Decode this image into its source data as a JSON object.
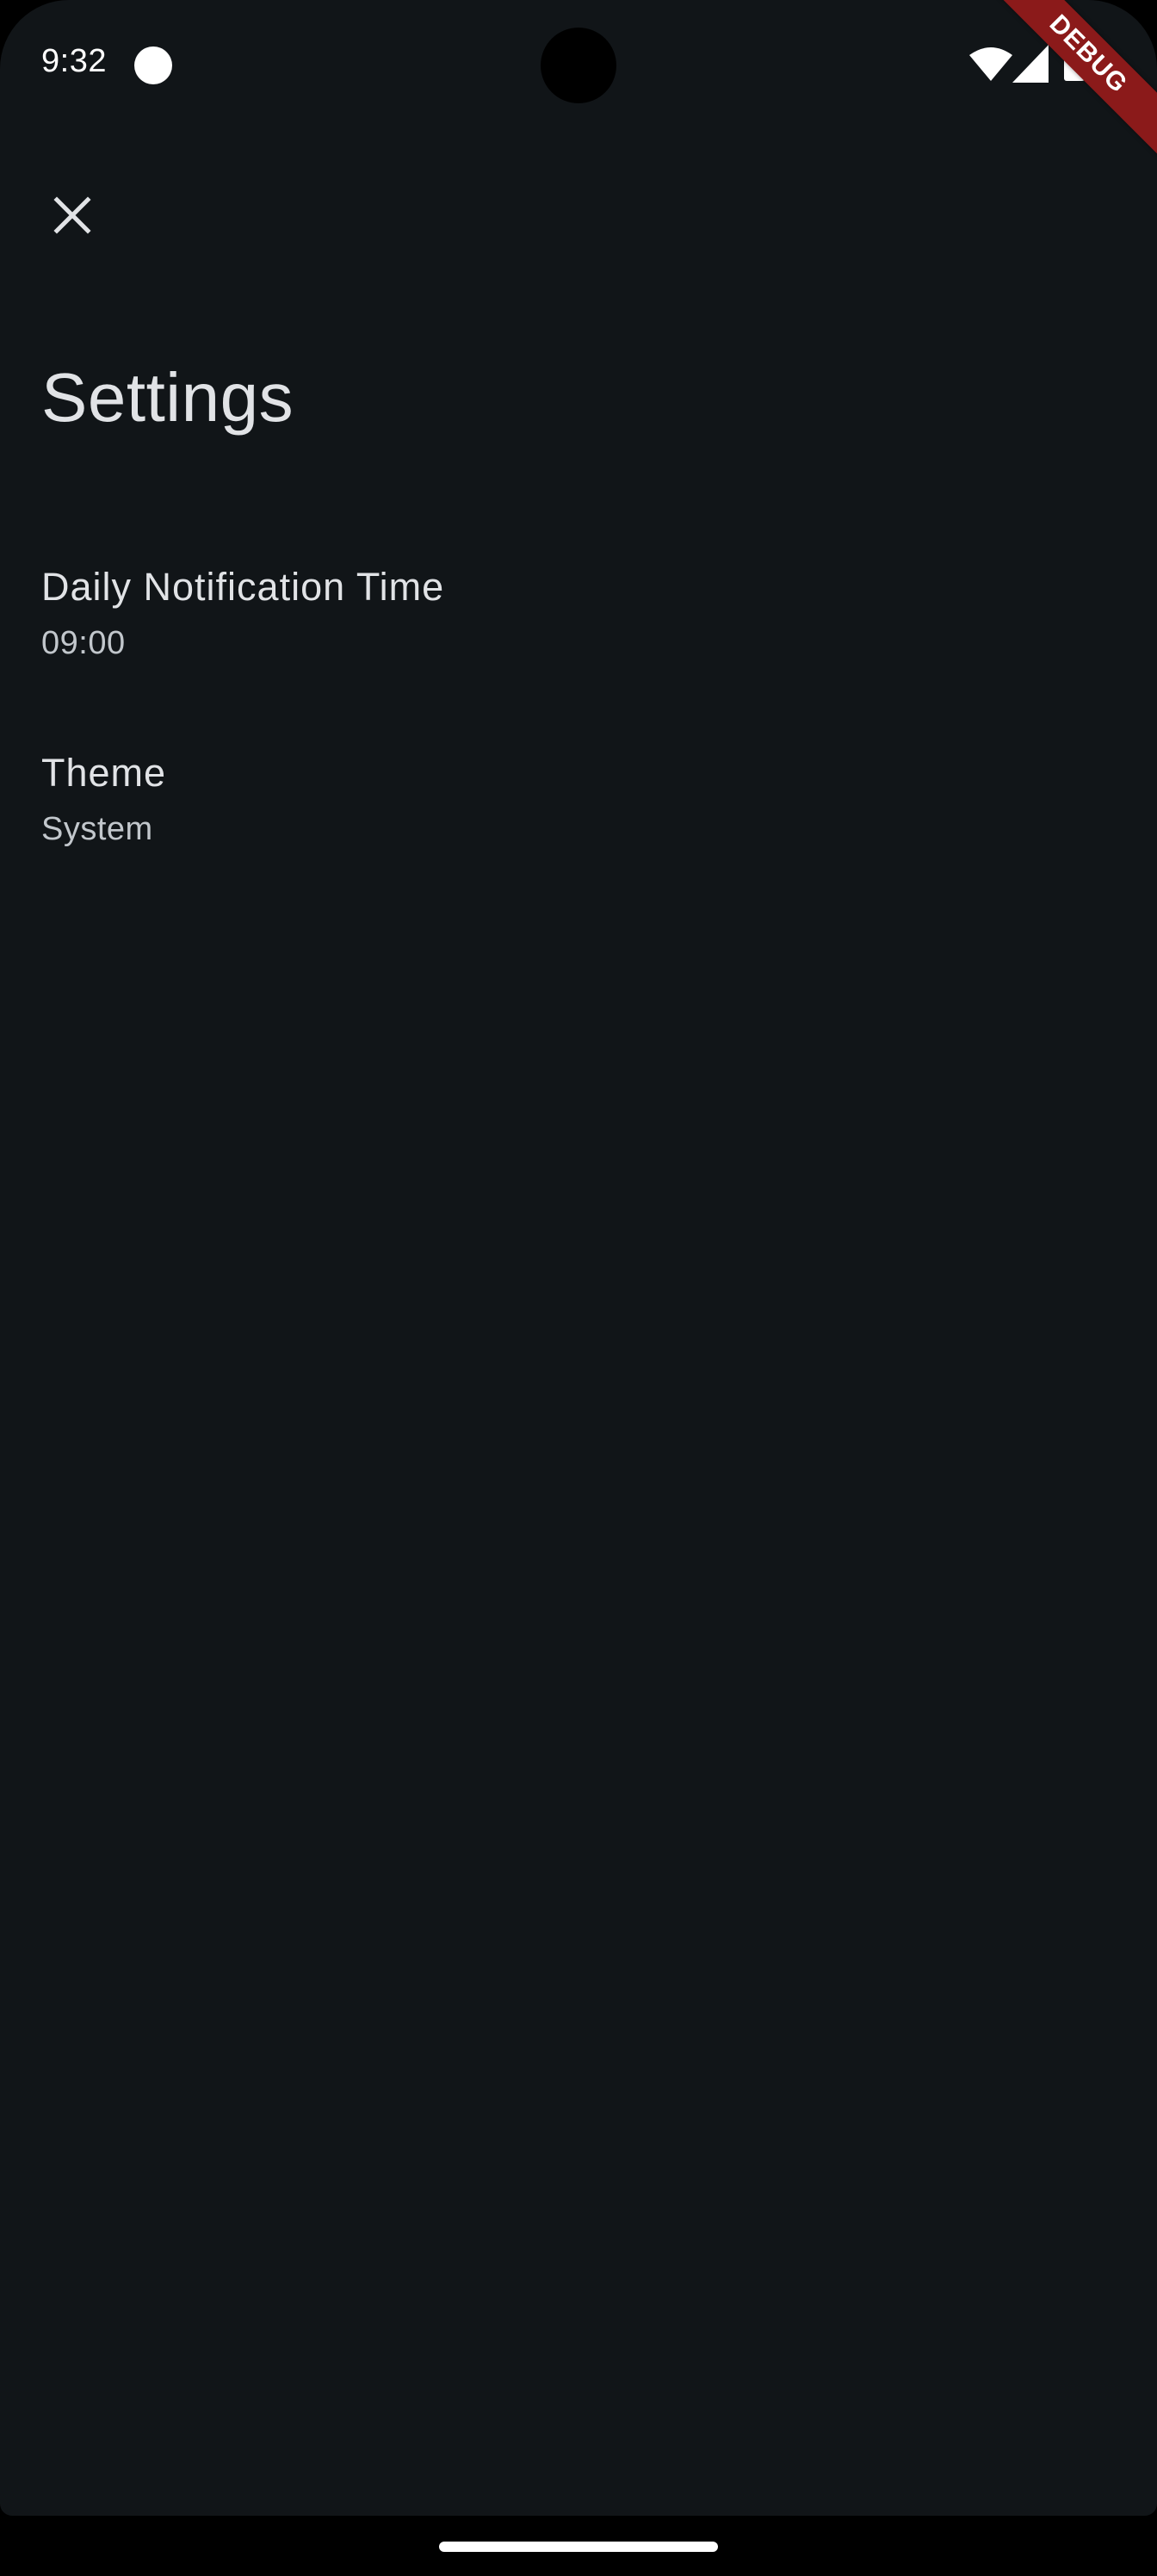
{
  "status_bar": {
    "time": "9:32",
    "icons": [
      "notification-dot-icon",
      "wifi-icon",
      "cellular-signal-icon",
      "battery-icon"
    ]
  },
  "debug_banner": "DEBUG",
  "app_bar": {
    "close_icon": "close-icon"
  },
  "page": {
    "title": "Settings"
  },
  "settings": {
    "items": [
      {
        "title": "Daily Notification Time",
        "value": "09:00"
      },
      {
        "title": "Theme",
        "value": "System"
      }
    ]
  },
  "colors": {
    "background": "#111518",
    "text_primary": "#e1e3e6",
    "text_secondary": "#c2c7cc",
    "debug_ribbon": "#8b1a1a"
  }
}
